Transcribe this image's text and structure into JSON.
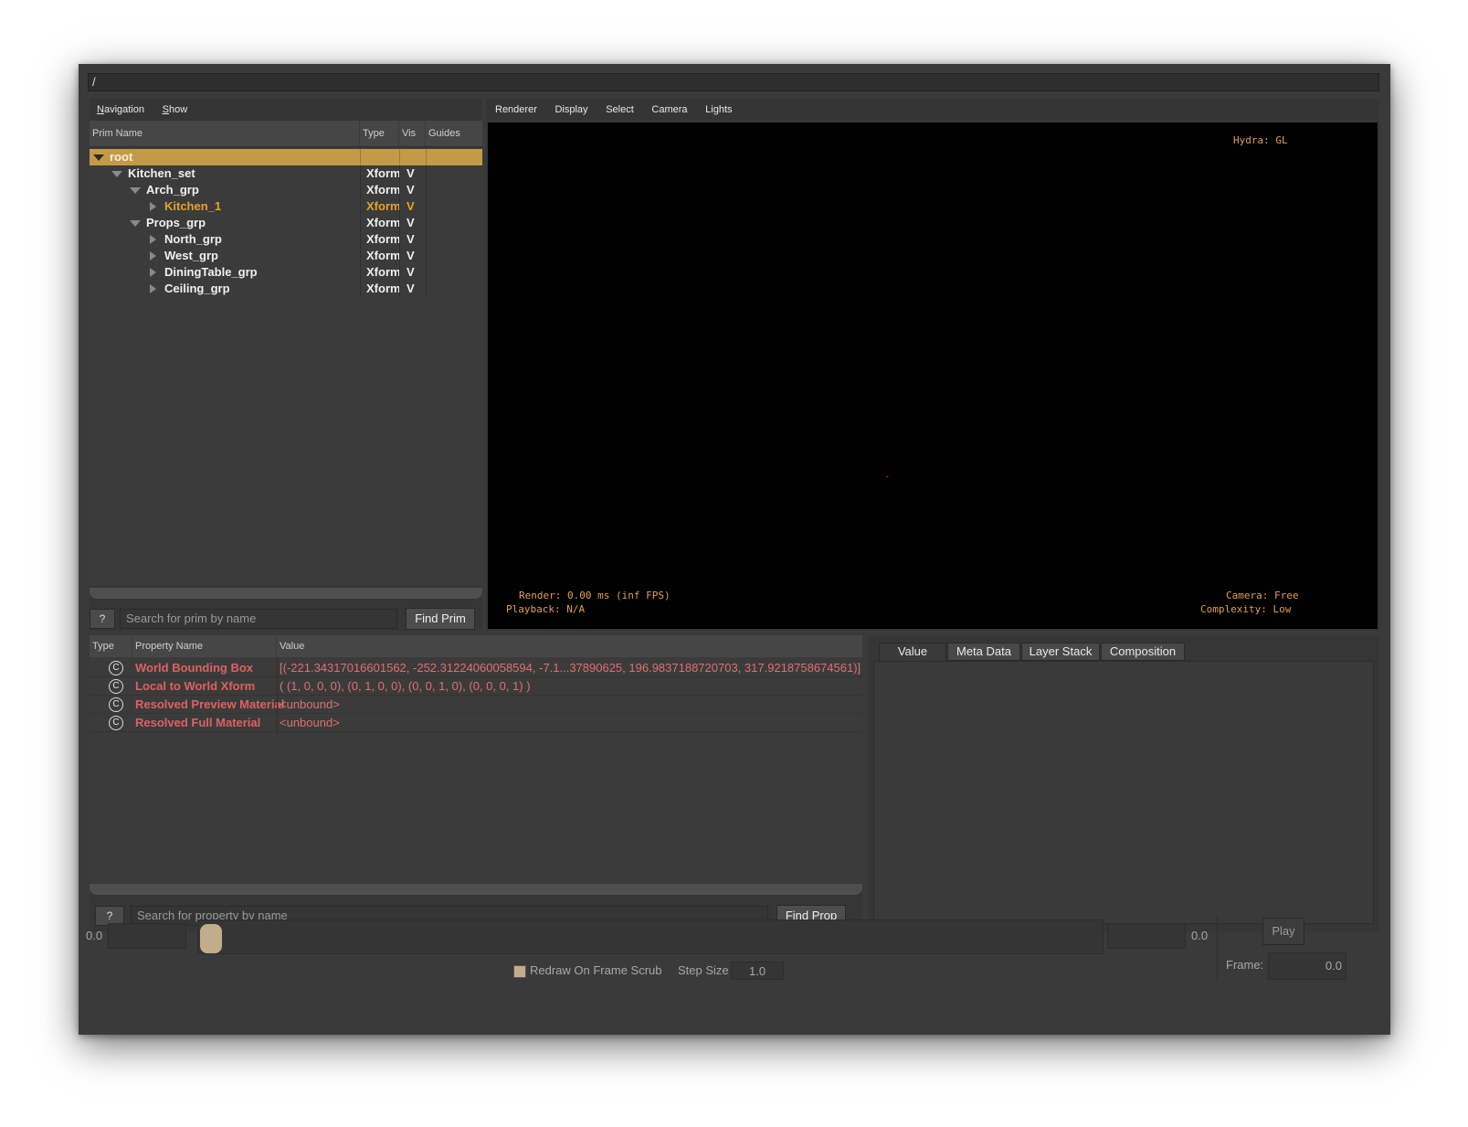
{
  "path_bar": "/",
  "prim_tree": {
    "menu": [
      {
        "label_pre": "",
        "label_u": "N",
        "label_post": "avigation"
      },
      {
        "label_pre": "",
        "label_u": "S",
        "label_post": "how"
      }
    ],
    "columns": [
      "Prim Name",
      "Type",
      "Vis",
      "Guides"
    ],
    "rows": [
      {
        "name": "root",
        "type": "",
        "vis": ""
      },
      {
        "name": "Kitchen_set",
        "type": "Xform",
        "vis": "V"
      },
      {
        "name": "Arch_grp",
        "type": "Xform",
        "vis": "V"
      },
      {
        "name": "Kitchen_1",
        "type": "Xform",
        "vis": "V"
      },
      {
        "name": "Props_grp",
        "type": "Xform",
        "vis": "V"
      },
      {
        "name": "North_grp",
        "type": "Xform",
        "vis": "V"
      },
      {
        "name": "West_grp",
        "type": "Xform",
        "vis": "V"
      },
      {
        "name": "DiningTable_grp",
        "type": "Xform",
        "vis": "V"
      },
      {
        "name": "Ceiling_grp",
        "type": "Xform",
        "vis": "V"
      }
    ],
    "help_label": "?",
    "search_placeholder": "Search for prim by name",
    "find_label": "Find Prim"
  },
  "viewport": {
    "menu": [
      "Renderer",
      "Display",
      "Select",
      "Camera",
      "Lights"
    ],
    "hud_renderer": "Hydra: GL",
    "hud_render": "Render: 0.00 ms (inf FPS)",
    "hud_playback": "Playback: N/A",
    "hud_camera": "Camera: Free",
    "hud_complexity": "Complexity: Low"
  },
  "properties": {
    "columns": [
      "Type",
      "Property Name",
      "Value"
    ],
    "rows": [
      {
        "type_glyph": "C",
        "name": "World Bounding Box",
        "value": "[(-221.34317016601562, -252.31224060058594, -7.1...37890625, 196.9837188720703, 317.9218758674561)]"
      },
      {
        "type_glyph": "C",
        "name": "Local to World Xform",
        "value": "( (1, 0, 0, 0), (0, 1, 0, 0), (0, 0, 1, 0), (0, 0, 0, 1) )"
      },
      {
        "type_glyph": "C",
        "name": "Resolved Preview Material",
        "value": "<unbound>"
      },
      {
        "type_glyph": "C",
        "name": "Resolved Full Material",
        "value": "<unbound>"
      }
    ],
    "help_label": "?",
    "search_placeholder": "Search for property by name",
    "find_label": "Find Prop"
  },
  "inspector": {
    "tabs": [
      "Value",
      "Meta Data",
      "Layer Stack",
      "Composition"
    ],
    "active_tab": 0
  },
  "timeline": {
    "start_value": "0.0",
    "end_value": "0.0",
    "play_label": "Play",
    "frame_label": "Frame:",
    "frame_value": "0.0",
    "redraw_label": "Redraw On Frame Scrub",
    "redraw_checked": true,
    "step_size_label": "Step Size",
    "step_size_value": "1.0"
  }
}
